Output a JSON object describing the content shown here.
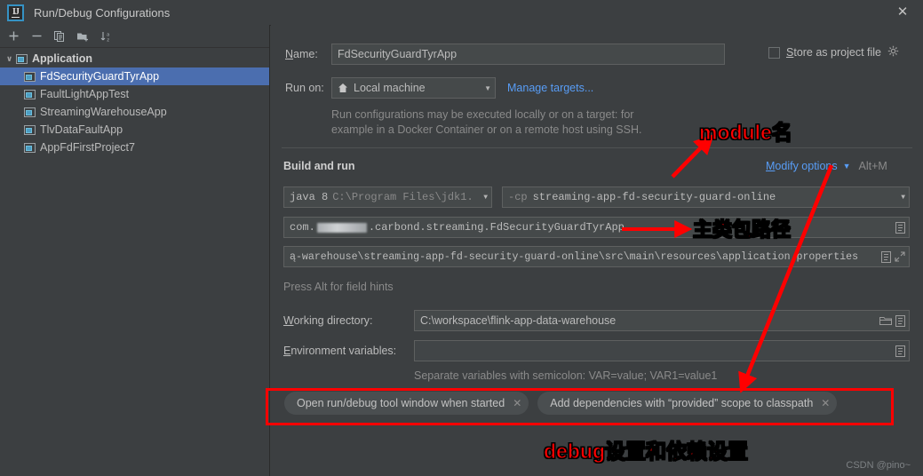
{
  "window": {
    "title": "Run/Debug Configurations",
    "logo_text": "IJ",
    "close_label": "✕"
  },
  "sidebar": {
    "toolbar": [
      {
        "name": "add-button",
        "label": "+"
      },
      {
        "name": "remove-button",
        "label": "−"
      },
      {
        "name": "copy-button",
        "label": "Copy Configuration"
      },
      {
        "name": "new-folder-button",
        "label": "Create New Folder"
      },
      {
        "name": "sort-alphabetically-button",
        "label": "Sort Configurations"
      }
    ],
    "group": {
      "label": "Application",
      "expanded_glyph": "∨"
    },
    "items": [
      {
        "label": "FdSecurityGuardTyrApp",
        "selected": true
      },
      {
        "label": "FaultLightAppTest",
        "selected": false
      },
      {
        "label": "StreamingWarehouseApp",
        "selected": false
      },
      {
        "label": "TlvDataFaultApp",
        "selected": false
      },
      {
        "label": "AppFdFirstProject7",
        "selected": false
      }
    ]
  },
  "form": {
    "name_label": "Name:",
    "name_mnemonic": "N",
    "name_label_rest": "ame:",
    "name_value": "FdSecurityGuardTyrApp",
    "store_as_project_file_label": "Store as project file",
    "store_as_project_file_mnemonic": "S",
    "store_as_project_file_rest": "tore as project file",
    "store_as_project_file_checked": false,
    "run_on_label": "Run on:",
    "run_on_value": "Local machine",
    "run_on_icon": "home-icon",
    "manage_targets_link": "Manage targets...",
    "description_line1": "Run configurations may be executed locally or on a target: for",
    "description_line2": "example in a Docker Container or on a remote host using SSH.",
    "build_and_run_title": "Build and run",
    "modify_options_mnemonic": "M",
    "modify_options_rest": "odify options",
    "modify_options_shortcut": "Alt+M",
    "jdk_value_prefix": "java 8",
    "jdk_value_path": "C:\\Program Files\\jdk1.",
    "classpath_prefix": "-cp",
    "classpath_value": "streaming-app-fd-security-guard-online",
    "main_class_prefix": "com.",
    "main_class_redacted": "",
    "main_class_suffix": ".carbond.streaming.FdSecurityGuardTyrApp",
    "program_args_value": "ą-warehouse\\streaming-app-fd-security-guard-online\\src\\main\\resources\\application.properties",
    "field_hints_text": "Press Alt for field hints",
    "working_directory_label": "Working directory:",
    "working_directory_mnemonic": "W",
    "working_directory_rest": "orking directory:",
    "working_directory_value": "C:\\workspace\\flink-app-data-warehouse",
    "environment_variables_label": "Environment variables:",
    "environment_variables_mnemonic": "E",
    "environment_variables_rest": "nvironment variables:",
    "environment_variables_value": "",
    "environment_hint": "Separate variables with semicolon: VAR=value; VAR1=value1"
  },
  "chips": [
    {
      "label": "Open run/debug tool window when started",
      "close_glyph": "✕"
    },
    {
      "label": "Add dependencies with “provided” scope to classpath",
      "close_glyph": "✕"
    }
  ],
  "annotations": [
    {
      "name": "annotation-module-name",
      "text": "module名"
    },
    {
      "name": "annotation-main-class-path",
      "text": "主类包路径"
    },
    {
      "name": "annotation-debug-and-dependency",
      "text": "debug设置和依赖设置"
    }
  ],
  "watermark": "CSDN @pino~",
  "colors": {
    "background": "#3c3f41",
    "field_background": "#45494a",
    "selection": "#4b6eaf",
    "link": "#589df6",
    "annotation_red": "#ff0000",
    "icon_cyan": "#4d9ec4",
    "text": "#bbbbbb"
  }
}
